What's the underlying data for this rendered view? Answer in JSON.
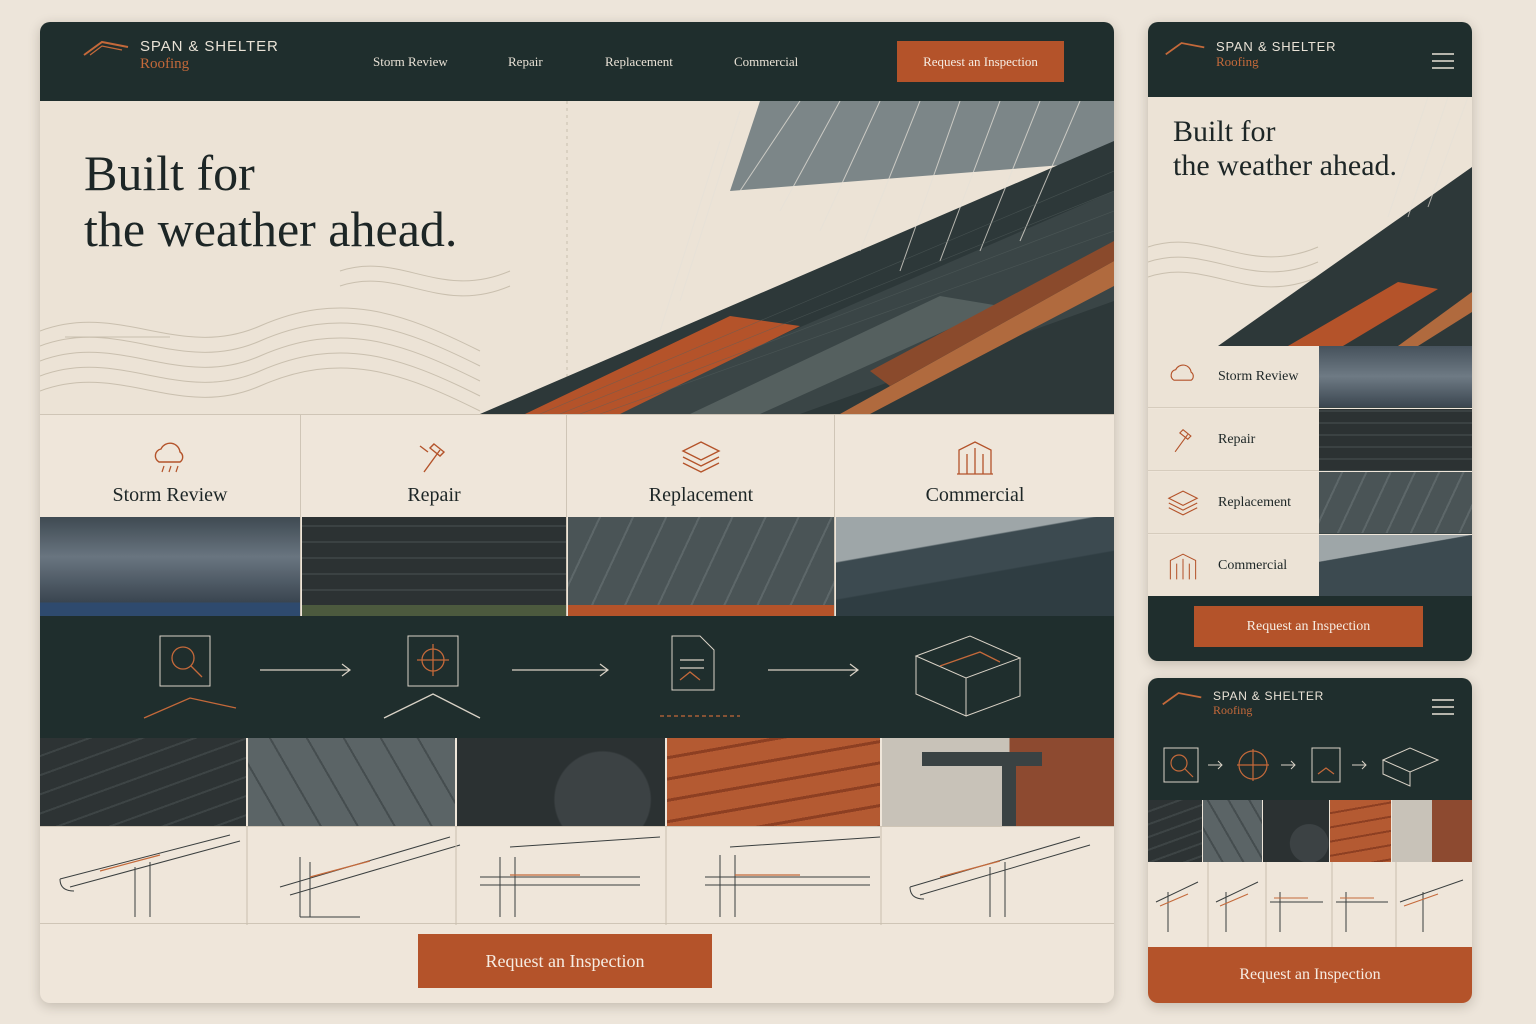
{
  "brand": {
    "name": "SPAN & SHELTER",
    "sub": "Roofing"
  },
  "nav": {
    "links": [
      "Storm Review",
      "Repair",
      "Replacement",
      "Commercial"
    ],
    "cta": "Request an Inspection"
  },
  "hero": {
    "line1": "Built for",
    "line2": "the weather ahead."
  },
  "services": [
    {
      "label": "Storm Review",
      "icon": "cloud-rain-icon"
    },
    {
      "label": "Repair",
      "icon": "hammer-icon"
    },
    {
      "label": "Replacement",
      "icon": "layers-icon"
    },
    {
      "label": "Commercial",
      "icon": "building-icon"
    }
  ],
  "process": {
    "steps": [
      "magnifier-roof-icon",
      "target-roof-icon",
      "document-icon",
      "roof-plan-icon"
    ]
  },
  "materials": [
    "asphalt-shingle",
    "standing-seam-metal",
    "membrane-roll",
    "clay-tile",
    "gutter-edge"
  ],
  "cta": {
    "label": "Request an Inspection"
  },
  "mobile": {
    "services": [
      "Storm Review",
      "Repair",
      "Replacement",
      "Commercial"
    ],
    "cta": "Request an Inspection",
    "menu_icon": "hamburger-menu-icon"
  },
  "colors": {
    "dark": "#1f2e2d",
    "accent": "#b4532a",
    "paper": "#ece3d6"
  }
}
